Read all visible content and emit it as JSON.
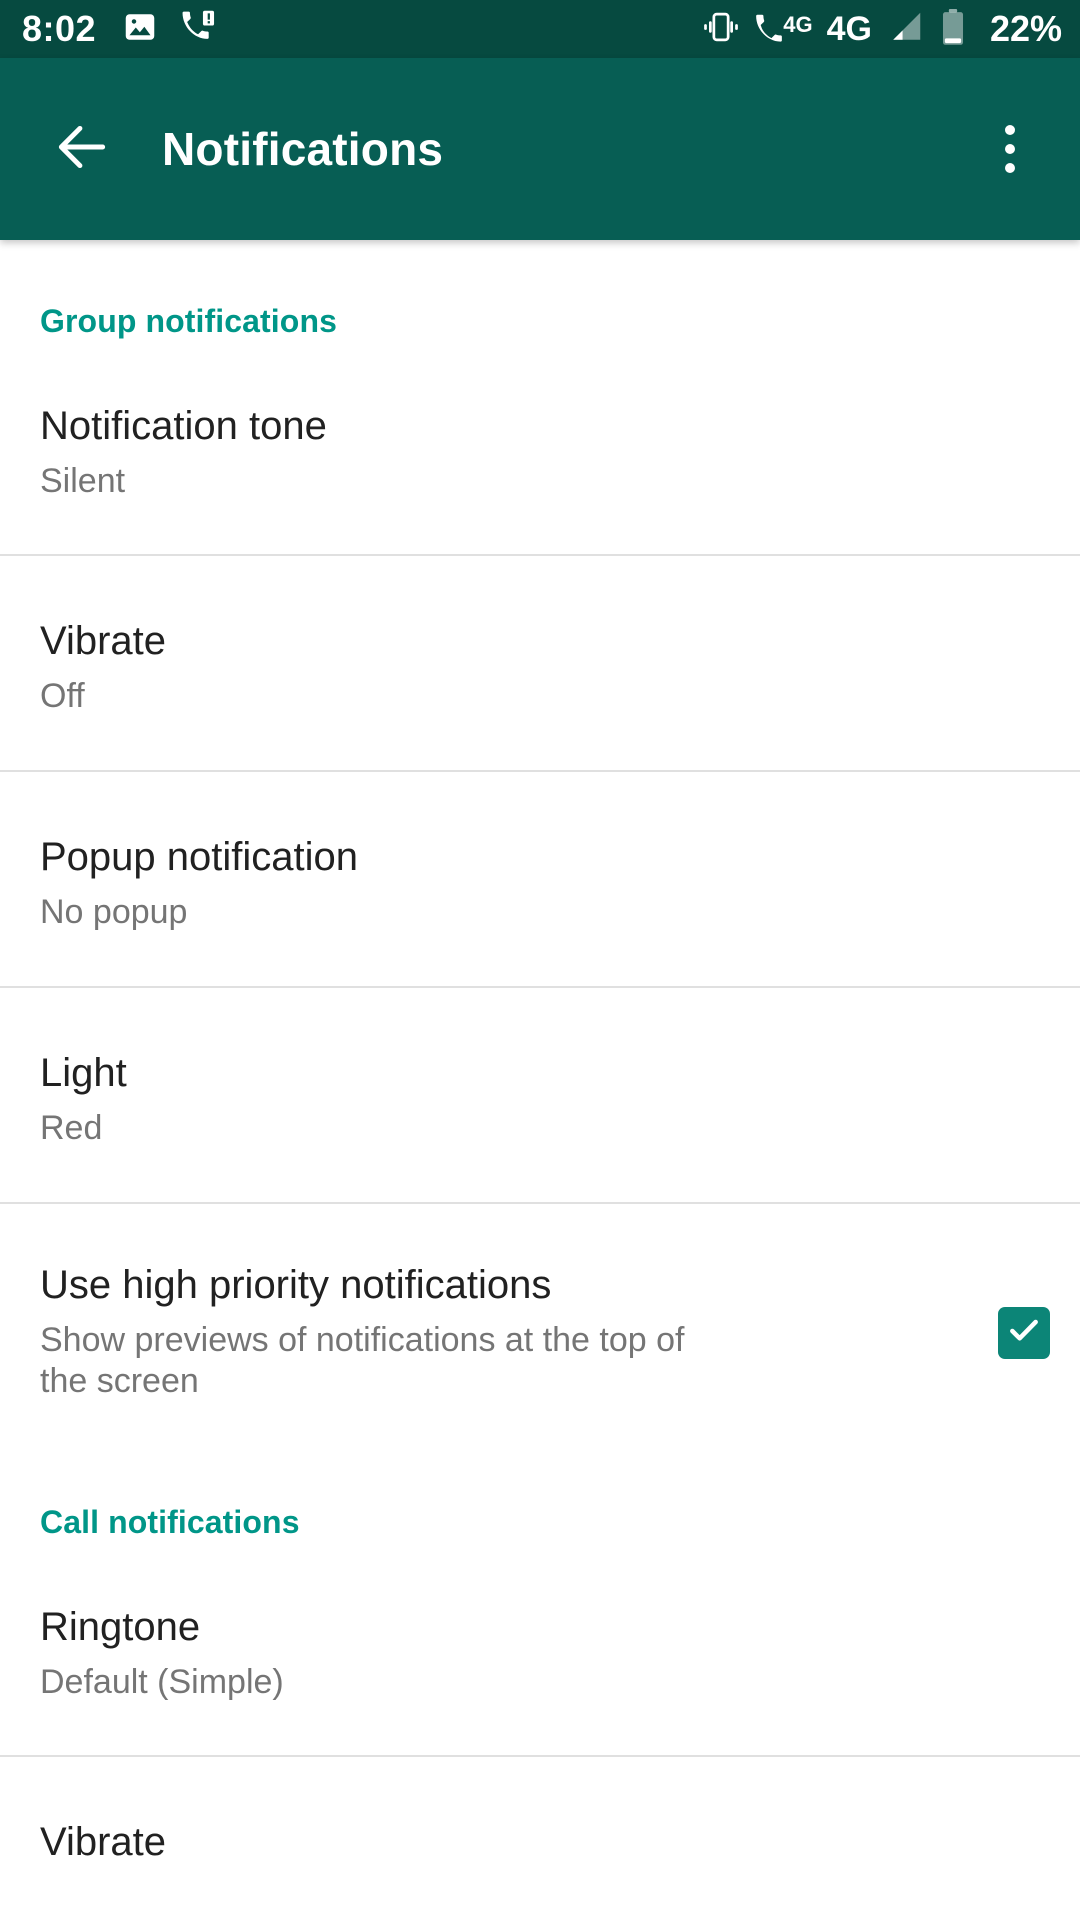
{
  "status_bar": {
    "clock": "8:02",
    "battery_percent": "22%",
    "network_label": "4G",
    "call_network_label": "4G",
    "left_icons": [
      "image-icon",
      "missed-call-icon"
    ],
    "right_icons": [
      "vibrate-icon",
      "call-4g-icon",
      "network-4g-label",
      "signal-bars-icon",
      "battery-icon"
    ],
    "bg_color": "#064a40"
  },
  "app_bar": {
    "title": "Notifications",
    "back_icon": "back-arrow-icon",
    "overflow_icon": "more-vert-icon",
    "bg_color": "#075e54"
  },
  "colors": {
    "accent": "#009688",
    "checkbox_fill": "#0c8577",
    "primary_text": "#212121",
    "secondary_text": "#757575",
    "divider": "#e0e0e0"
  },
  "sections": [
    {
      "header": "Group notifications",
      "items": [
        {
          "title": "Notification tone",
          "subtitle": "Silent",
          "has_checkbox": false
        },
        {
          "title": "Vibrate",
          "subtitle": "Off",
          "has_checkbox": false
        },
        {
          "title": "Popup notification",
          "subtitle": "No popup",
          "has_checkbox": false
        },
        {
          "title": "Light",
          "subtitle": "Red",
          "has_checkbox": false
        },
        {
          "title": "Use high priority notifications",
          "subtitle": "Show previews of notifications at the top of the screen",
          "has_checkbox": true,
          "checked": true
        }
      ]
    },
    {
      "header": "Call notifications",
      "items": [
        {
          "title": "Ringtone",
          "subtitle": "Default (Simple)",
          "has_checkbox": false
        },
        {
          "title": "Vibrate",
          "subtitle": "",
          "has_checkbox": false
        }
      ]
    }
  ]
}
